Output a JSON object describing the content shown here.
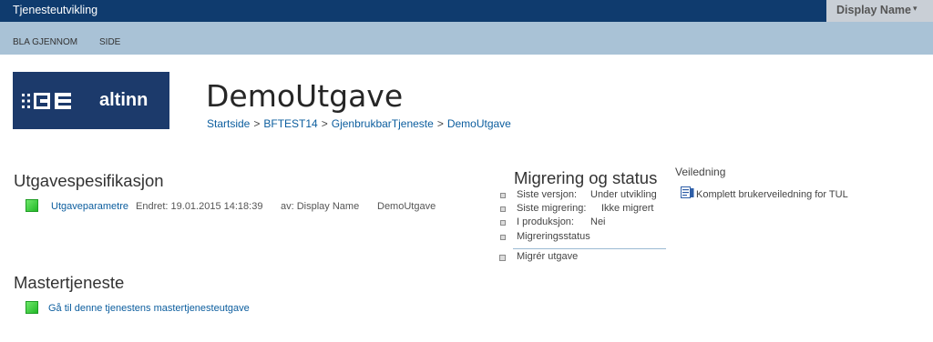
{
  "header": {
    "app_title": "Tjenesteutvikling",
    "user_name": "Display Name",
    "user_caret": "▾"
  },
  "ribbon": {
    "tabs": [
      {
        "label": "BLA GJENNOM"
      },
      {
        "label": "SIDE"
      }
    ]
  },
  "logo": {
    "text": "altinn"
  },
  "page": {
    "title": "DemoUtgave",
    "breadcrumb": [
      "Startside",
      "BFTEST14",
      "GjenbrukbarTjeneste",
      "DemoUtgave"
    ],
    "breadcrumb_separator": ">"
  },
  "spec": {
    "heading": "Utgavespesifikasjon",
    "item": {
      "link": "Utgaveparametre",
      "changed": "Endret: 19.01.2015 14:18:39",
      "by": "av: Display Name",
      "name": "DemoUtgave"
    }
  },
  "master": {
    "heading": "Mastertjeneste",
    "link": "Gå til denne tjenestens mastertjenesteutgave"
  },
  "migration": {
    "heading": "Migrering og status",
    "rows": [
      {
        "label": "Siste versjon:",
        "value": "Under utvikling"
      },
      {
        "label": "Siste migrering:",
        "value": "Ikke migrert"
      },
      {
        "label": "I produksjon:",
        "value": "Nei"
      }
    ],
    "status_link": "Migreringsstatus",
    "action_link": "Migrér utgave"
  },
  "guidance": {
    "heading": "Veiledning",
    "link": "Komplett brukerveiledning for TUL"
  },
  "colors": {
    "topbar": "#0f3b6e",
    "ribbon": "#a9c2d6",
    "link": "#0b5d9e",
    "logo_bg": "#1c3a6b"
  }
}
